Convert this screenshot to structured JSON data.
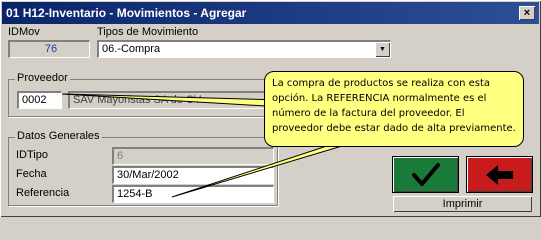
{
  "window": {
    "title": "H12-Inventario - Movimientos - Agregar",
    "icon_text": "01",
    "close_symbol": "×"
  },
  "form": {
    "idmov_label": "IDMov",
    "idmov_value": "76",
    "tipos_label": "Tipos de Movimiento",
    "tipos_value": "06.-Compra",
    "proveedor_group": "Proveedor",
    "proveedor_code": "0002",
    "proveedor_name": "SAV Mayoristas SA de CV",
    "datos_group": "Datos Generales",
    "idtipo_label": "IDTipo",
    "idtipo_value": "6",
    "fecha_label": "Fecha",
    "fecha_value": "30/Mar/2002",
    "referencia_label": "Referencia",
    "referencia_value": "1254-B"
  },
  "buttons": {
    "ok_icon": "check-icon",
    "back_icon": "arrow-left-icon",
    "print_label": "Imprimir"
  },
  "tooltip": {
    "text": "La compra de productos se realiza con esta opción. La REFERENCIA normalmente es el número de la factura del proveedor. El proveedor debe estar dado de alta previamente."
  },
  "colors": {
    "titlebar": "#0a246a",
    "ok_button": "#1a7a3a",
    "back_button": "#c81c1c",
    "tooltip_bg": "#ffff80"
  }
}
